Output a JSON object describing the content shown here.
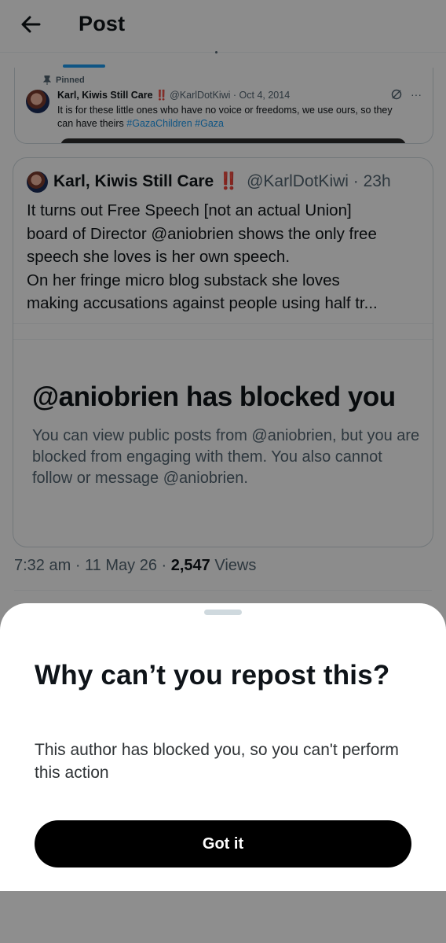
{
  "header": {
    "title": "Post"
  },
  "pinned": {
    "label": "Pinned",
    "name": "Karl, Kiwis Still Care",
    "bang": "‼️",
    "handle_date": "@KarlDotKiwi · Oct 4, 2014",
    "text": "It is for these little ones who have no voice or freedoms, we use ours, so they can have theirs",
    "tag1": "#GazaChildren",
    "tag2": "#Gaza"
  },
  "post": {
    "name": "Karl, Kiwis Still Care",
    "bang": "‼️",
    "handle_time": "@KarlDotKiwi · 23h",
    "lines": [
      "It turns out Free Speech [not an actual Union]",
      "board of Director @aniobrien shows the only free",
      "speech she loves is her own speech.",
      "On her fringe micro blog substack she loves",
      "making accusations against people using half tr..."
    ],
    "blocked_title": "@aniobrien has blocked you",
    "blocked_text": "You can view public posts from @aniobrien, but you are blocked from engaging with them. You also cannot follow or message @aniobrien."
  },
  "stats": {
    "time": "7:32 am · 11 May 26 · ",
    "views_count": "2,547",
    "views_label": " Views"
  },
  "sheet": {
    "title": "Why can’t you repost this?",
    "text": "This author has blocked you, so you can't perform this action",
    "button": "Got it"
  },
  "colors": {
    "accent": "#1d9bf0",
    "warning": "#e0245e",
    "button": "#000000"
  },
  "icons": [
    "back-arrow-icon",
    "pin-icon",
    "grok-icon",
    "more-icon"
  ]
}
